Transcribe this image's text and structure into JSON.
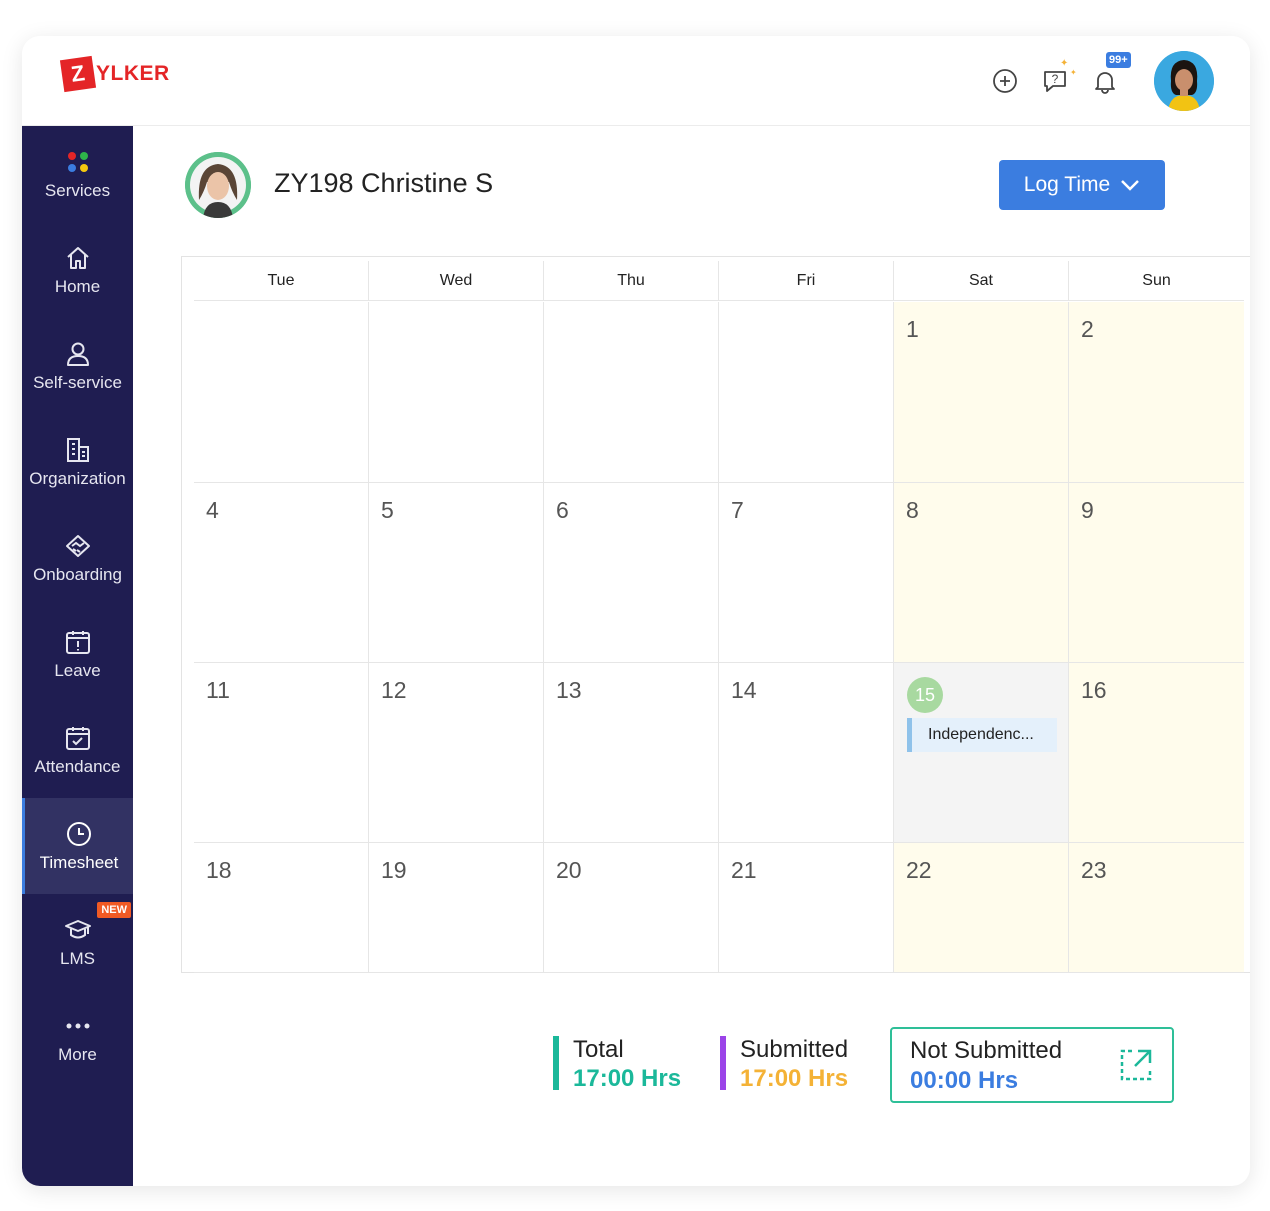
{
  "brand": {
    "logo_letter": "Z",
    "logo_text": "YLKER",
    "accent": "#e42527"
  },
  "header": {
    "icons": [
      "add-circle-icon",
      "help-chat-icon",
      "bell-icon"
    ],
    "notification_count": "99+"
  },
  "sidebar": {
    "background": "#1f1d51",
    "items": [
      {
        "label": "Services",
        "icon": "grid-dots-icon"
      },
      {
        "label": "Home",
        "icon": "home-icon"
      },
      {
        "label": "Self-service",
        "icon": "user-icon"
      },
      {
        "label": "Organization",
        "icon": "building-icon"
      },
      {
        "label": "Onboarding",
        "icon": "handshake-icon"
      },
      {
        "label": "Leave",
        "icon": "calendar-leave-icon"
      },
      {
        "label": "Attendance",
        "icon": "calendar-check-icon"
      },
      {
        "label": "Timesheet",
        "icon": "clock-icon",
        "active": true
      },
      {
        "label": "LMS",
        "icon": "graduation-cap-icon",
        "badge": "NEW"
      },
      {
        "label": "More",
        "icon": "more-dots-icon"
      }
    ]
  },
  "employee": {
    "name": "ZY198 Christine S"
  },
  "actions": {
    "log_time_label": "Log Time"
  },
  "calendar": {
    "weekdays": [
      "Tue",
      "Wed",
      "Thu",
      "Fri",
      "Sat",
      "Sun"
    ],
    "weeks": [
      [
        "",
        "",
        "",
        "",
        "1",
        "2"
      ],
      [
        "4",
        "5",
        "6",
        "7",
        "8",
        "9"
      ],
      [
        "11",
        "12",
        "13",
        "14",
        "15",
        "16"
      ],
      [
        "18",
        "19",
        "20",
        "21",
        "22",
        "23"
      ]
    ],
    "today": "15",
    "event": {
      "day": "15",
      "label": "Independenc..."
    }
  },
  "summary": {
    "total": {
      "label": "Total",
      "value": "17:00 Hrs",
      "color": "#1bb89a"
    },
    "submitted": {
      "label": "Submitted",
      "value": "17:00 Hrs",
      "color": "#f4b236",
      "bar_color": "#9b44e8"
    },
    "not_submitted": {
      "label": "Not Submitted",
      "value": "00:00 Hrs",
      "color": "#3b7de0"
    }
  }
}
